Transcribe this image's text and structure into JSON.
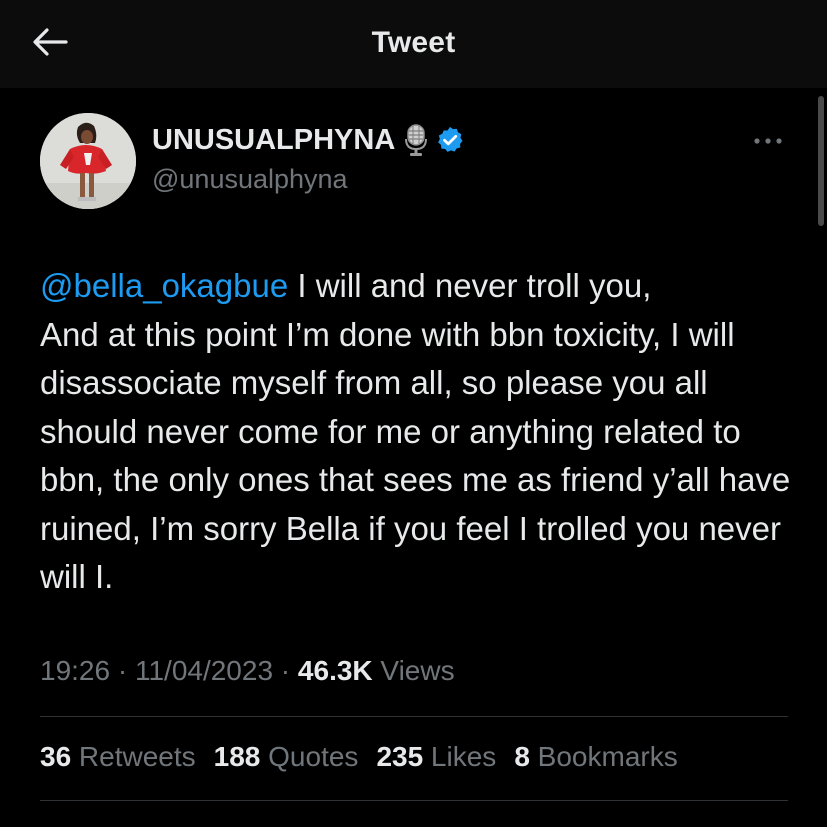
{
  "header": {
    "title": "Tweet",
    "back_icon": "arrow-left-icon"
  },
  "author": {
    "name": "UNUSUALPHYNA",
    "handle": "@unusualphyna",
    "badge_icon": "microphone-icon",
    "verified_icon": "verified-badge-icon",
    "verified_color": "#1d9bf0"
  },
  "more_icon": "more-horizontal-icon",
  "tweet": {
    "mention": "@bella_okagbue",
    "body": " I will and never troll you,\nAnd at this point I’m done with bbn toxicity, I will disassociate myself from all, so please you all should never come for me or anything related to bbn, the only ones that sees me as friend y’all have ruined, I’m sorry Bella if you feel I trolled you never will I."
  },
  "meta": {
    "time": "19:26",
    "sep1": " · ",
    "date": "11/04/2023",
    "sep2": " · ",
    "views_count": "46.3K",
    "views_label": " Views"
  },
  "stats": {
    "retweets_count": "36",
    "retweets_label": " Retweets",
    "quotes_count": "188",
    "quotes_label": " Quotes",
    "likes_count": "235",
    "likes_label": " Likes",
    "bookmarks_count": "8",
    "bookmarks_label": " Bookmarks"
  },
  "colors": {
    "background": "#000000",
    "header_bg": "#0c0c0c",
    "text": "#e7e9ea",
    "secondary_text": "#71767b",
    "link": "#1d9bf0",
    "divider": "#2f3336"
  }
}
